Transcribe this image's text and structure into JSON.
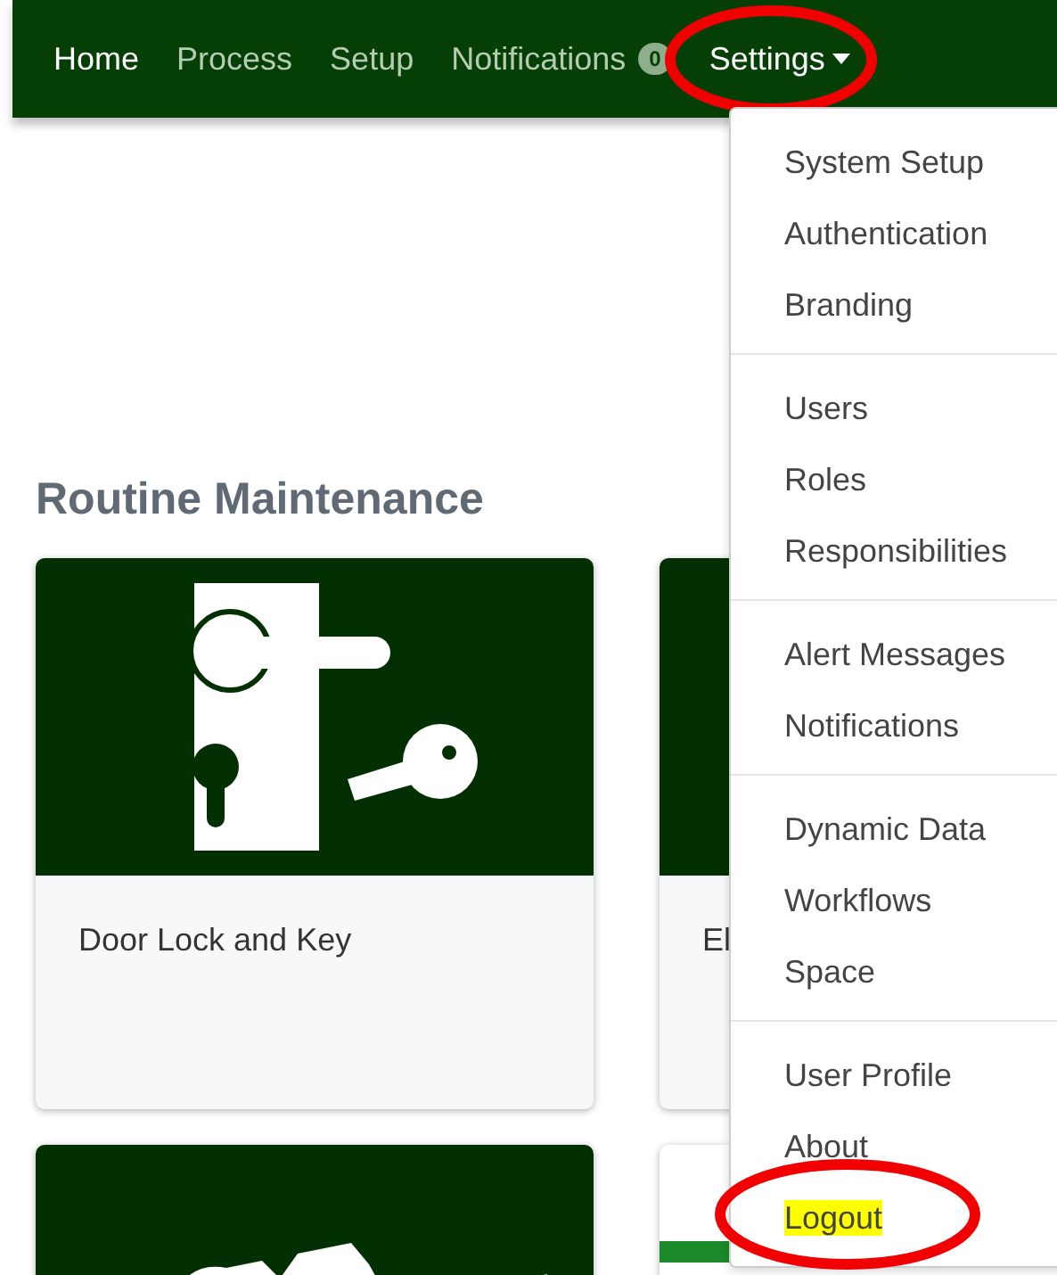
{
  "navbar": {
    "items": [
      {
        "label": "Home",
        "selected": true,
        "circled": false
      },
      {
        "label": "Process",
        "selected": false,
        "circled": false
      },
      {
        "label": "Setup",
        "selected": false,
        "circled": false
      },
      {
        "label": "Notifications",
        "selected": false,
        "circled": false,
        "badge": "0"
      },
      {
        "label": "Settings",
        "selected": true,
        "circled": true,
        "kind": "dropdown",
        "expanded": true
      }
    ]
  },
  "heading": "Routine Maintenance",
  "cards": [
    {
      "title": "Door Lock and Key",
      "kind": "lock"
    },
    {
      "title": "El",
      "kind": "plain"
    },
    {
      "kind": "figures"
    },
    {
      "kind": "light"
    }
  ],
  "settings_menu": {
    "groups": [
      {
        "items": [
          {
            "label": "System Setup",
            "highlighted": false,
            "circled": false
          },
          {
            "label": "Authentication",
            "highlighted": false,
            "circled": false
          },
          {
            "label": "Branding",
            "highlighted": false,
            "circled": false
          }
        ]
      },
      {
        "items": [
          {
            "label": "Users",
            "highlighted": false,
            "circled": false
          },
          {
            "label": "Roles",
            "highlighted": false,
            "circled": false
          },
          {
            "label": "Responsibilities",
            "highlighted": false,
            "circled": false
          }
        ]
      },
      {
        "items": [
          {
            "label": "Alert Messages",
            "highlighted": false,
            "circled": false
          },
          {
            "label": "Notifications",
            "highlighted": false,
            "circled": false
          }
        ]
      },
      {
        "items": [
          {
            "label": "Dynamic Data",
            "highlighted": false,
            "circled": false
          },
          {
            "label": "Workflows",
            "highlighted": false,
            "circled": false
          },
          {
            "label": "Space",
            "highlighted": false,
            "circled": false
          }
        ]
      },
      {
        "items": [
          {
            "label": "User Profile",
            "highlighted": false,
            "circled": false
          },
          {
            "label": "About",
            "highlighted": false,
            "circled": false
          },
          {
            "label": "Logout",
            "highlighted": true,
            "circled": true
          }
        ]
      }
    ]
  }
}
